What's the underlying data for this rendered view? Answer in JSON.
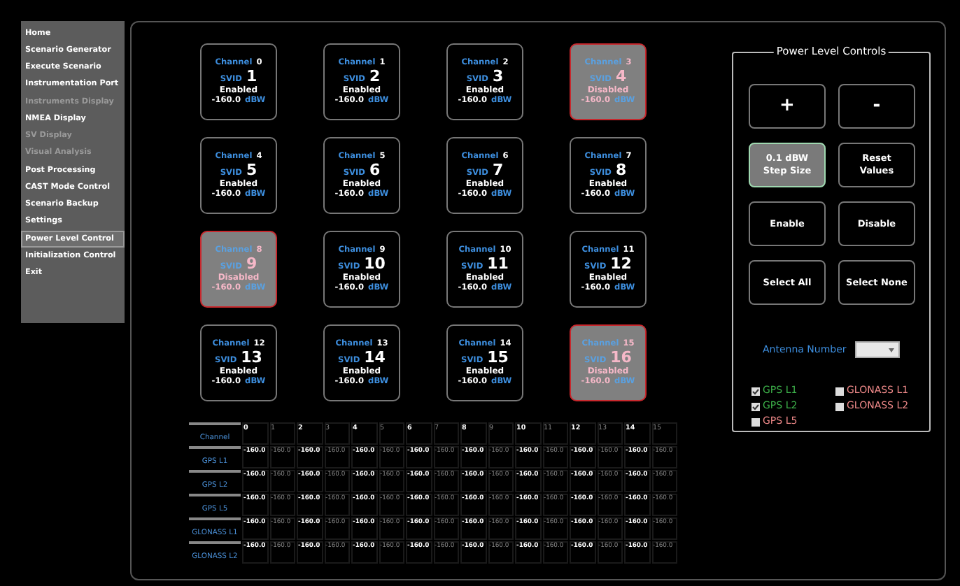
{
  "sidebar": {
    "items": [
      {
        "label": "Home",
        "disabled": false,
        "selected": false
      },
      {
        "label": "Scenario Generator",
        "disabled": false,
        "selected": false
      },
      {
        "label": "Execute Scenario",
        "disabled": false,
        "selected": false
      },
      {
        "label": "Instrumentation Port",
        "disabled": false,
        "selected": false
      },
      {
        "label": "Instruments Display",
        "disabled": true,
        "selected": false
      },
      {
        "label": "NMEA Display",
        "disabled": false,
        "selected": false
      },
      {
        "label": "SV Display",
        "disabled": true,
        "selected": false
      },
      {
        "label": "Visual Analysis",
        "disabled": true,
        "selected": false
      },
      {
        "label": "Post Processing",
        "disabled": false,
        "selected": false
      },
      {
        "label": "CAST Mode Control",
        "disabled": false,
        "selected": false
      },
      {
        "label": "Scenario Backup",
        "disabled": false,
        "selected": false
      },
      {
        "label": "Settings",
        "disabled": false,
        "selected": false
      },
      {
        "label": "Power Level Control",
        "disabled": false,
        "selected": true
      },
      {
        "label": "Initialization Control",
        "disabled": false,
        "selected": false
      },
      {
        "label": "Exit",
        "disabled": false,
        "selected": false
      }
    ]
  },
  "channels": [
    {
      "channel_label": "Channel",
      "channel": "0",
      "svid_label": "SVID",
      "svid": "1",
      "enabled": true,
      "status": "Enabled",
      "power": "-160.0",
      "unit": "dBW"
    },
    {
      "channel_label": "Channel",
      "channel": "1",
      "svid_label": "SVID",
      "svid": "2",
      "enabled": true,
      "status": "Enabled",
      "power": "-160.0",
      "unit": "dBW"
    },
    {
      "channel_label": "Channel",
      "channel": "2",
      "svid_label": "SVID",
      "svid": "3",
      "enabled": true,
      "status": "Enabled",
      "power": "-160.0",
      "unit": "dBW"
    },
    {
      "channel_label": "Channel",
      "channel": "3",
      "svid_label": "SVID",
      "svid": "4",
      "enabled": false,
      "status": "Disabled",
      "power": "-160.0",
      "unit": "dBW"
    },
    {
      "channel_label": "Channel",
      "channel": "4",
      "svid_label": "SVID",
      "svid": "5",
      "enabled": true,
      "status": "Enabled",
      "power": "-160.0",
      "unit": "dBW"
    },
    {
      "channel_label": "Channel",
      "channel": "5",
      "svid_label": "SVID",
      "svid": "6",
      "enabled": true,
      "status": "Enabled",
      "power": "-160.0",
      "unit": "dBW"
    },
    {
      "channel_label": "Channel",
      "channel": "6",
      "svid_label": "SVID",
      "svid": "7",
      "enabled": true,
      "status": "Enabled",
      "power": "-160.0",
      "unit": "dBW"
    },
    {
      "channel_label": "Channel",
      "channel": "7",
      "svid_label": "SVID",
      "svid": "8",
      "enabled": true,
      "status": "Enabled",
      "power": "-160.0",
      "unit": "dBW"
    },
    {
      "channel_label": "Channel",
      "channel": "8",
      "svid_label": "SVID",
      "svid": "9",
      "enabled": false,
      "status": "Disabled",
      "power": "-160.0",
      "unit": "dBW"
    },
    {
      "channel_label": "Channel",
      "channel": "9",
      "svid_label": "SVID",
      "svid": "10",
      "enabled": true,
      "status": "Enabled",
      "power": "-160.0",
      "unit": "dBW"
    },
    {
      "channel_label": "Channel",
      "channel": "10",
      "svid_label": "SVID",
      "svid": "11",
      "enabled": true,
      "status": "Enabled",
      "power": "-160.0",
      "unit": "dBW"
    },
    {
      "channel_label": "Channel",
      "channel": "11",
      "svid_label": "SVID",
      "svid": "12",
      "enabled": true,
      "status": "Enabled",
      "power": "-160.0",
      "unit": "dBW"
    },
    {
      "channel_label": "Channel",
      "channel": "12",
      "svid_label": "SVID",
      "svid": "13",
      "enabled": true,
      "status": "Enabled",
      "power": "-160.0",
      "unit": "dBW"
    },
    {
      "channel_label": "Channel",
      "channel": "13",
      "svid_label": "SVID",
      "svid": "14",
      "enabled": true,
      "status": "Enabled",
      "power": "-160.0",
      "unit": "dBW"
    },
    {
      "channel_label": "Channel",
      "channel": "14",
      "svid_label": "SVID",
      "svid": "15",
      "enabled": true,
      "status": "Enabled",
      "power": "-160.0",
      "unit": "dBW"
    },
    {
      "channel_label": "Channel",
      "channel": "15",
      "svid_label": "SVID",
      "svid": "16",
      "enabled": false,
      "status": "Disabled",
      "power": "-160.0",
      "unit": "dBW"
    }
  ],
  "power_panel": {
    "title": "Power Level Controls",
    "buttons": [
      {
        "label": "+",
        "selected": false
      },
      {
        "label": "-",
        "selected": false
      },
      {
        "label": "0.1 dBW Step Size",
        "selected": true
      },
      {
        "label": "Reset Values",
        "selected": false
      },
      {
        "label": "Enable",
        "selected": false
      },
      {
        "label": "Disable",
        "selected": false
      },
      {
        "label": "Select All",
        "selected": false
      },
      {
        "label": "Select None",
        "selected": false
      }
    ],
    "antenna_label": "Antenna Number",
    "signals": [
      {
        "label": "GPS L1",
        "checked": true
      },
      {
        "label": "GPS L2",
        "checked": true
      },
      {
        "label": "GPS L5",
        "checked": false
      },
      {
        "label": "GLONASS L1",
        "checked": false
      },
      {
        "label": "GLONASS L2",
        "checked": false
      }
    ]
  },
  "table": {
    "corner": "Channel",
    "columns": [
      {
        "label": "0",
        "active": true
      },
      {
        "label": "1",
        "active": false
      },
      {
        "label": "2",
        "active": true
      },
      {
        "label": "3",
        "active": false
      },
      {
        "label": "4",
        "active": true
      },
      {
        "label": "5",
        "active": false
      },
      {
        "label": "6",
        "active": true
      },
      {
        "label": "7",
        "active": false
      },
      {
        "label": "8",
        "active": true
      },
      {
        "label": "9",
        "active": false
      },
      {
        "label": "10",
        "active": true
      },
      {
        "label": "11",
        "active": false
      },
      {
        "label": "12",
        "active": true
      },
      {
        "label": "13",
        "active": false
      },
      {
        "label": "14",
        "active": true
      },
      {
        "label": "15",
        "active": false
      }
    ],
    "rows": [
      {
        "label": "GPS L1",
        "cells": [
          "-160.0",
          "-160.0",
          "-160.0",
          "-160.0",
          "-160.0",
          "-160.0",
          "-160.0",
          "-160.0",
          "-160.0",
          "-160.0",
          "-160.0",
          "-160.0",
          "-160.0",
          "-160.0",
          "-160.0",
          "-160.0"
        ]
      },
      {
        "label": "GPS L2",
        "cells": [
          "-160.0",
          "-160.0",
          "-160.0",
          "-160.0",
          "-160.0",
          "-160.0",
          "-160.0",
          "-160.0",
          "-160.0",
          "-160.0",
          "-160.0",
          "-160.0",
          "-160.0",
          "-160.0",
          "-160.0",
          "-160.0"
        ]
      },
      {
        "label": "GPS L5",
        "cells": [
          "-160.0",
          "-160.0",
          "-160.0",
          "-160.0",
          "-160.0",
          "-160.0",
          "-160.0",
          "-160.0",
          "-160.0",
          "-160.0",
          "-160.0",
          "-160.0",
          "-160.0",
          "-160.0",
          "-160.0",
          "-160.0"
        ]
      },
      {
        "label": "GLONASS L1",
        "cells": [
          "-160.0",
          "-160.0",
          "-160.0",
          "-160.0",
          "-160.0",
          "-160.0",
          "-160.0",
          "-160.0",
          "-160.0",
          "-160.0",
          "-160.0",
          "-160.0",
          "-160.0",
          "-160.0",
          "-160.0",
          "-160.0"
        ]
      },
      {
        "label": "GLONASS L2",
        "cells": [
          "-160.0",
          "-160.0",
          "-160.0",
          "-160.0",
          "-160.0",
          "-160.0",
          "-160.0",
          "-160.0",
          "-160.0",
          "-160.0",
          "-160.0",
          "-160.0",
          "-160.0",
          "-160.0",
          "-160.0",
          "-160.0"
        ]
      }
    ]
  }
}
